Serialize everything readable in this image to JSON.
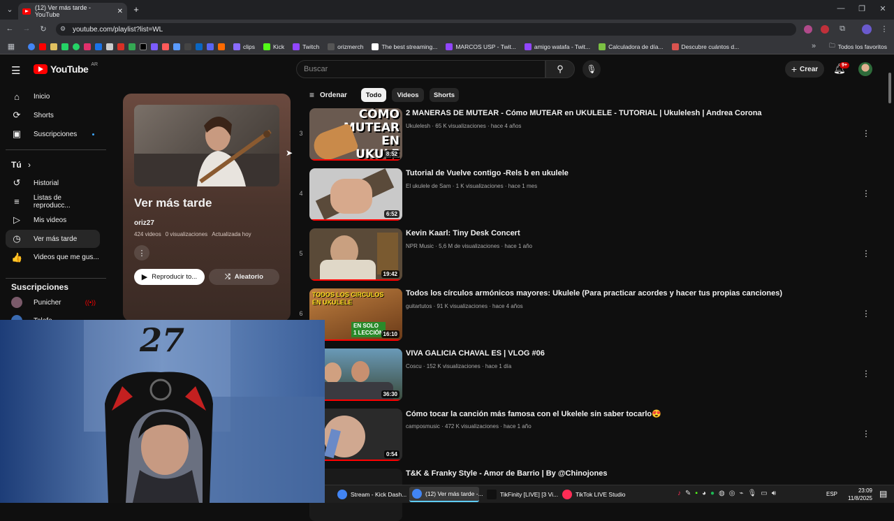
{
  "browser": {
    "tab_title": "(12) Ver más tarde - YouTube",
    "url": "youtube.com/playlist?list=WL",
    "bookmarks": [
      {
        "label": "clips",
        "color": "#8a6cff"
      },
      {
        "label": "Kick",
        "color": "#53fc18"
      },
      {
        "label": "Twitch",
        "color": "#9146ff"
      },
      {
        "label": "orizmerch",
        "color": "#555555"
      },
      {
        "label": "The best streaming...",
        "color": "#ffffff"
      },
      {
        "label": "MARCOS USP - Twit...",
        "color": "#9146ff"
      },
      {
        "label": "amigo watafa - Twit...",
        "color": "#9146ff"
      },
      {
        "label": "Calculadora de día...",
        "color": "#7bc043"
      },
      {
        "label": "Descubre cuántos d...",
        "color": "#d9534f"
      }
    ],
    "all_favorites": "Todos los favoritos"
  },
  "youtube": {
    "logo_text": "YouTube",
    "logo_region": "AR",
    "search_placeholder": "Buscar",
    "create_label": "Crear",
    "notifications_badge": "9+"
  },
  "sidebar": {
    "main": [
      {
        "label": "Inicio",
        "icon": "home-icon",
        "glyph": "⌂"
      },
      {
        "label": "Shorts",
        "icon": "shorts-icon",
        "glyph": "⟳"
      },
      {
        "label": "Suscripciones",
        "icon": "subscriptions-icon",
        "glyph": "▣"
      }
    ],
    "you_heading": "Tú",
    "you": [
      {
        "label": "Historial",
        "icon": "history-icon",
        "glyph": "↺"
      },
      {
        "label": "Listas de reproducc...",
        "icon": "playlists-icon",
        "glyph": "≡"
      },
      {
        "label": "Mis videos",
        "icon": "my-videos-icon",
        "glyph": "▷"
      },
      {
        "label": "Ver más tarde",
        "icon": "watch-later-icon",
        "glyph": "◷"
      },
      {
        "label": "Videos que me gus...",
        "icon": "liked-icon",
        "glyph": "👍"
      }
    ],
    "subs_heading": "Suscripciones",
    "subs": [
      {
        "label": "Punicher"
      },
      {
        "label": "Telefe"
      }
    ]
  },
  "playlist": {
    "title": "Ver más tarde",
    "owner": "oriz27",
    "videos_count": "424 videos",
    "views": "0 visualizaciones",
    "updated": "Actualizada hoy",
    "play_all": "Reproducir to...",
    "shuffle": "Aleatorio"
  },
  "filters": {
    "sort": "Ordenar",
    "chips": [
      "Todo",
      "Videos",
      "Shorts"
    ]
  },
  "videos": [
    {
      "index": "3",
      "title": "2 MANERAS DE MUTEAR - Cómo MUTEAR en UKULELE - TUTORIAL | Ukulelesh | Andrea Corona",
      "meta": "Ukulelesh · 65 K visualizaciones · hace 4 años",
      "duration": "8:52",
      "bg": "#6a5a50"
    },
    {
      "index": "4",
      "title": "Tutorial de Vuelve contigo -Rels b en ukulele",
      "meta": "El ukulele de Sam · 1 K visualizaciones · hace 1 mes",
      "duration": "6:52",
      "bg": "#c9c9c9"
    },
    {
      "index": "5",
      "title": "Kevin Kaarl: Tiny Desk Concert",
      "meta": "NPR Music · 5,6 M de visualizaciones · hace 1 año",
      "duration": "19:42",
      "bg": "#5a4a38"
    },
    {
      "index": "6",
      "title": "Todos los círculos armónicos mayores: Ukulele (Para practicar acordes y hacer tus propias canciones)",
      "meta": "guitartutos · 91 K visualizaciones · hace 4 años",
      "duration": "16:10",
      "bg": "#8a5a2a"
    },
    {
      "index": "",
      "title": "VIVA GALICIA CHAVAL ES | VLOG #06",
      "meta": "Coscu · 152 K visualizaciones · hace 1 día",
      "duration": "36:30",
      "bg": "#3a5a6a"
    },
    {
      "index": "",
      "title": "Cómo tocar la canción más famosa con el Ukelele sin saber tocarlo😍",
      "meta": "camposmusic · 472 K visualizaciones · hace 1 año",
      "duration": "0:54",
      "bg": "#2a2a2a"
    },
    {
      "index": "",
      "title": "T&K & Franky Style - Amor de Barrio | By @Chinojones",
      "meta": "",
      "duration": "",
      "bg": "#1a1a1a"
    }
  ],
  "thumb_texts": {
    "v3_line1": "CÓMO",
    "v3_line2": "MUTEAR",
    "v3_line3": "EN",
    "v3_line4": "UKULE",
    "v6_line1": "TODOS LOS CIRCULOS",
    "v6_line2": "EN UKULELE",
    "v6_line3": "EN SOLO",
    "v6_line4": "1 LECCIÓN"
  },
  "taskbar": {
    "apps": [
      {
        "label": "Stream - Kick Dash...",
        "color": "#4285f4"
      },
      {
        "label": "(12) Ver más tarde -...",
        "color": "#4285f4"
      },
      {
        "label": "TikFinity [LIVE] [3 Vi...",
        "color": "#111111"
      },
      {
        "label": "TikTok LIVE Studio",
        "color": "#fe2c55"
      }
    ],
    "lang": "ESP",
    "time": "23:09",
    "date": "11/8/2025"
  },
  "webcam_text": "27"
}
